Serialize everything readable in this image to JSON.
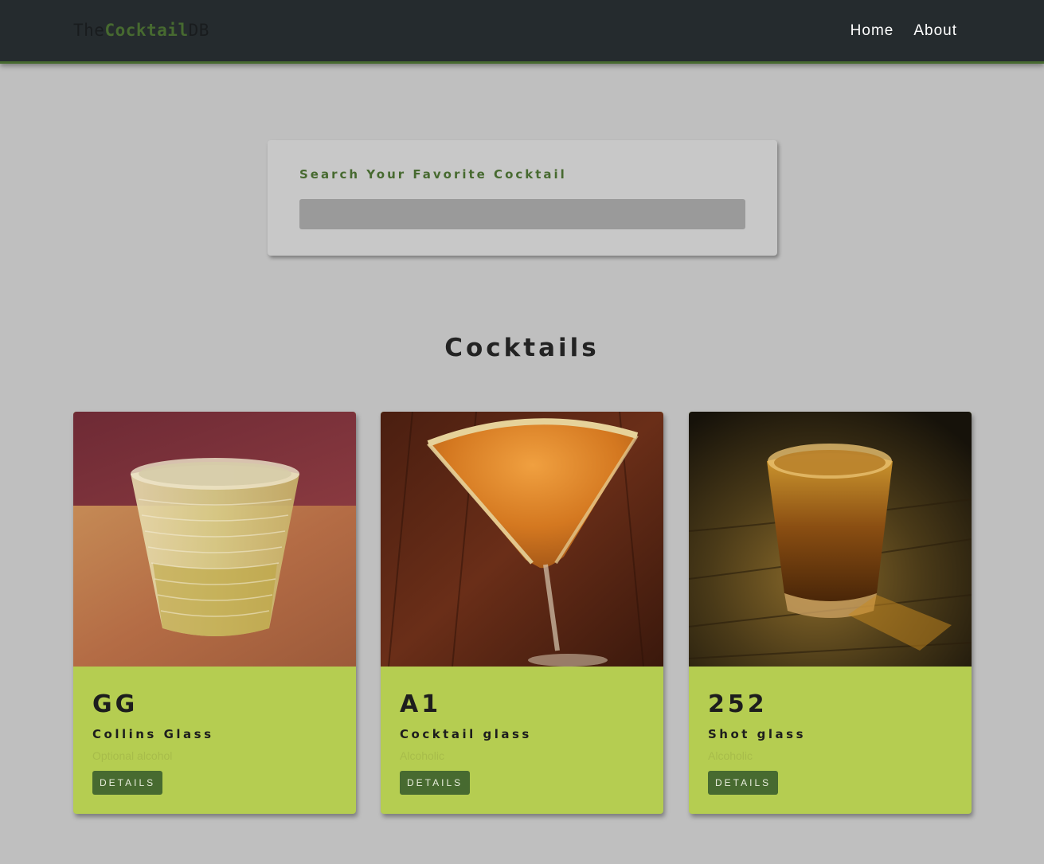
{
  "navbar": {
    "logo": {
      "part1": "The",
      "part2": "Cocktail",
      "part3": "DB"
    },
    "links": [
      "Home",
      "About"
    ]
  },
  "search": {
    "label": "Search Your Favorite Cocktail",
    "value": ""
  },
  "section": {
    "title": "Cocktails"
  },
  "cocktails": [
    {
      "name": "GG",
      "glass": "Collins Glass",
      "alcoholic": "Optional alcohol",
      "button": "DETAILS",
      "image": "cocktail-photo-gg"
    },
    {
      "name": "A1",
      "glass": "Cocktail glass",
      "alcoholic": "Alcoholic",
      "button": "DETAILS",
      "image": "cocktail-photo-a1"
    },
    {
      "name": "252",
      "glass": "Shot glass",
      "alcoholic": "Alcoholic",
      "button": "DETAILS",
      "image": "cocktail-photo-252"
    }
  ],
  "colors": {
    "navbar": "#252b2e",
    "brand_green": "#476a30",
    "card_green": "#b5cd51",
    "page_bg": "#bfbfbf"
  }
}
